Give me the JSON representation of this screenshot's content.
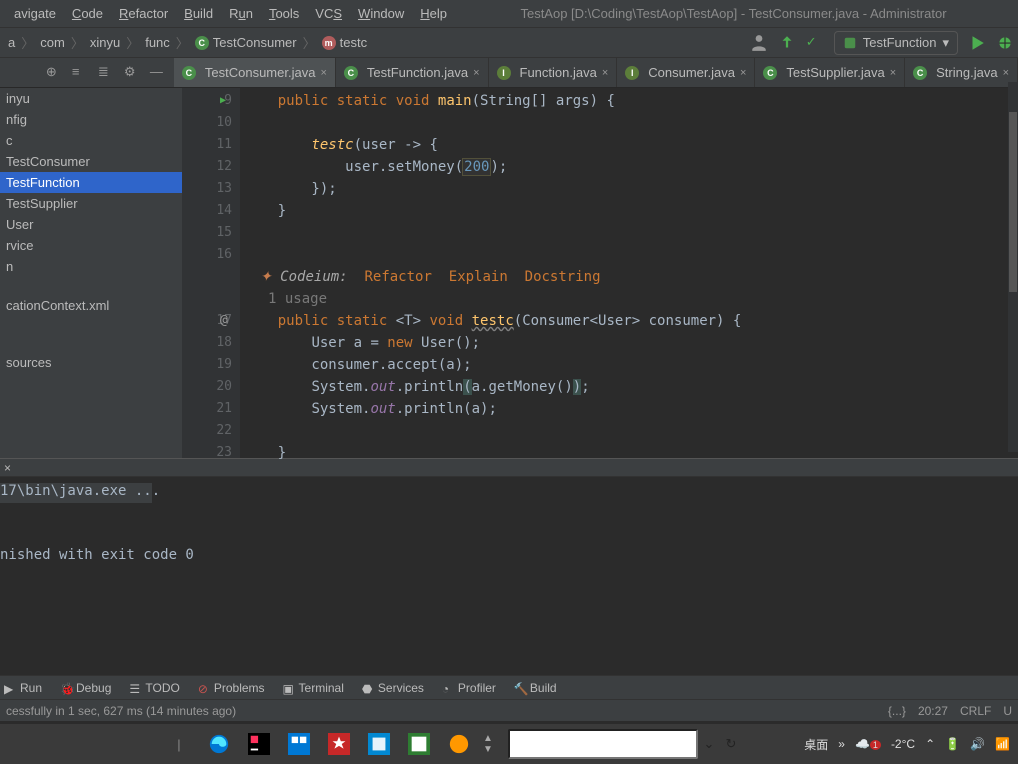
{
  "menu": [
    "avigate",
    "Code",
    "Refactor",
    "Build",
    "Run",
    "Tools",
    "VCS",
    "Window",
    "Help"
  ],
  "window_title": "TestAop [D:\\Coding\\TestAop\\TestAop] - TestConsumer.java - Administrator",
  "breadcrumb": [
    "a",
    "com",
    "xinyu",
    "func",
    "TestConsumer",
    "testc"
  ],
  "run_config": "TestFunction",
  "tabs": [
    {
      "label": "TestConsumer.java",
      "active": true
    },
    {
      "label": "TestFunction.java",
      "active": false
    },
    {
      "label": "Function.java",
      "active": false
    },
    {
      "label": "Consumer.java",
      "active": false
    },
    {
      "label": "TestSupplier.java",
      "active": false
    },
    {
      "label": "String.java",
      "active": false
    }
  ],
  "tree": [
    "inyu",
    "nfig",
    "c",
    "TestConsumer",
    "TestFunction",
    "TestSupplier",
    "User",
    "rvice",
    "n",
    "cationContext.xml",
    "",
    "",
    "sources"
  ],
  "tree_selected_index": 4,
  "gutter": [
    "9",
    "10",
    "11",
    "12",
    "13",
    "14",
    "15",
    "16",
    "",
    "",
    "17",
    "18",
    "19",
    "20",
    "21",
    "22",
    "23"
  ],
  "codeium_prefix": "Codeium:",
  "codeium_links": [
    "Refactor",
    "Explain",
    "Docstring"
  ],
  "usage_text": "1 usage",
  "code": {
    "l9": {
      "pre": "    ",
      "kw": "public static",
      "sp": " ",
      "void": "void",
      "sp2": " ",
      "fn": "main",
      "rest": "(String[] args) {"
    },
    "l11": {
      "pre": "        ",
      "fn": "testc",
      "rest": "(user -> {"
    },
    "l12": {
      "pre": "            ",
      "v": "user",
      "c": ".setMoney(",
      "n": "200",
      "t": ");"
    },
    "l13": "        });",
    "l14": "    }",
    "l17": {
      "pre": "    ",
      "kw": "public static",
      "gen": " <T> ",
      "void": "void",
      "sp": " ",
      "fn": "testc",
      "rest": "(Consumer<User> consumer) {"
    },
    "l18": {
      "pre": "        ",
      "t1": "User a = ",
      "kw": "new",
      "t2": " User();"
    },
    "l19": "        consumer.accept(a);",
    "l20": {
      "pre": "        ",
      "t1": "System.",
      "f": "out",
      "t2": ".println",
      "p1": "(",
      "t3": "a.getMoney()",
      "p2": ")",
      "t4": ";"
    },
    "l21": {
      "pre": "        ",
      "t1": "System.",
      "f": "out",
      "t2": ".println(a);"
    },
    "l23": "    }"
  },
  "console": {
    "l1": "17\\bin\\java.exe ...",
    "l2": "nished with exit code 0"
  },
  "toolwindows": [
    {
      "icon": "play",
      "label": "Run"
    },
    {
      "icon": "bug",
      "label": "Debug"
    },
    {
      "icon": "todo",
      "label": "TODO"
    },
    {
      "icon": "problems",
      "label": "Problems"
    },
    {
      "icon": "terminal",
      "label": "Terminal"
    },
    {
      "icon": "services",
      "label": "Services"
    },
    {
      "icon": "profiler",
      "label": "Profiler"
    },
    {
      "icon": "build",
      "label": "Build"
    }
  ],
  "status": {
    "left": "cessfully in 1 sec, 627 ms (14 minutes ago)",
    "col": "20:27",
    "crlf": "CRLF",
    "enc": "U",
    "braces": "{...}"
  },
  "taskbar": {
    "desktop": "桌面",
    "temp": "-2°C"
  }
}
